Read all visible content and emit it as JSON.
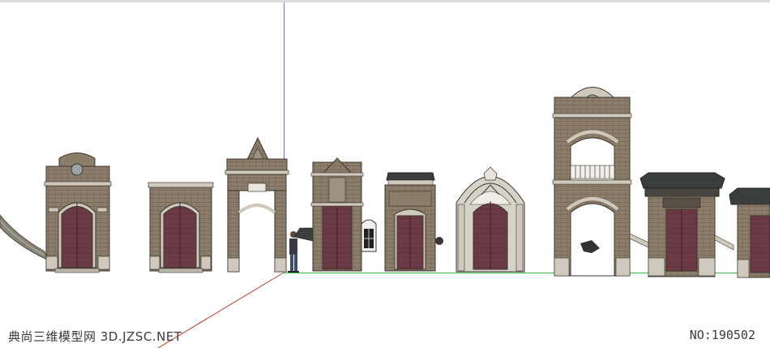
{
  "watermark": {
    "left_text": "典尚三维模型网 3D.JZSC.NET",
    "right_text": "NO:190502"
  },
  "scene": {
    "description_items": [
      {
        "id": "stair-rail",
        "icon": "rail-icon"
      },
      {
        "id": "gate-1"
      },
      {
        "id": "gate-2"
      },
      {
        "id": "gate-3"
      },
      {
        "id": "person"
      },
      {
        "id": "gate-4"
      },
      {
        "id": "gate-5"
      },
      {
        "id": "gate-6"
      },
      {
        "id": "gate-7"
      },
      {
        "id": "gate-8"
      },
      {
        "id": "gate-9"
      }
    ],
    "colors": {
      "brick": "#8d7f6b",
      "brick_dark": "#6e6353",
      "stone": "#cfc9bd",
      "stone_dark": "#a9a398",
      "door": "#6b3a45",
      "door_dark": "#4a2630",
      "roof": "#3a3f3d",
      "axis_red": "#c0392b",
      "axis_blue": "#6f6fd9",
      "axis_green": "#39b54a"
    }
  }
}
